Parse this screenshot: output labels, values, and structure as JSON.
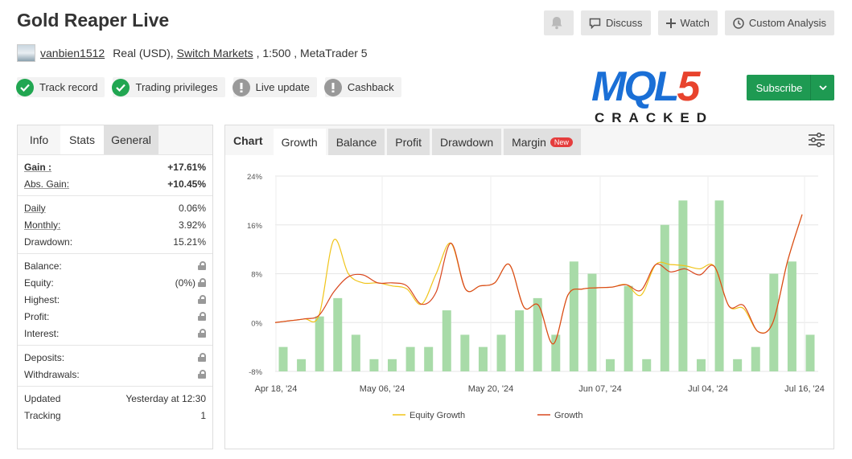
{
  "header": {
    "title": "Gold Reaper Live"
  },
  "buttons": {
    "discuss": "Discuss",
    "watch": "Watch",
    "custom": "Custom Analysis"
  },
  "account": {
    "user": "vanbien1512",
    "type": "Real (USD),",
    "broker": "Switch Markets",
    "rest": ", 1:500 , MetaTrader 5"
  },
  "badges": [
    {
      "label": "Track record"
    },
    {
      "label": "Trading privileges"
    },
    {
      "label": "Live update"
    },
    {
      "label": "Cashback"
    }
  ],
  "logo": {
    "big_a": "MQL",
    "big_b": "5",
    "small": "CRACKED"
  },
  "subscribe": {
    "label": "Subscribe"
  },
  "left_tabs": {
    "info": "Info",
    "stats": "Stats",
    "general": "General"
  },
  "stats": {
    "gain": {
      "k": "Gain :",
      "v": "+17.61%"
    },
    "abs_gain": {
      "k": "Abs. Gain:",
      "v": "+10.45%"
    },
    "daily": {
      "k": "Daily",
      "v": "0.06%"
    },
    "monthly": {
      "k": "Monthly:",
      "v": "3.92%"
    },
    "drawdown": {
      "k": "Drawdown:",
      "v": "15.21%"
    },
    "balance": {
      "k": "Balance:"
    },
    "equity": {
      "k": "Equity:",
      "v": "(0%)"
    },
    "highest": {
      "k": "Highest:"
    },
    "profit": {
      "k": "Profit:"
    },
    "interest": {
      "k": "Interest:"
    },
    "deposits": {
      "k": "Deposits:"
    },
    "withdrawals": {
      "k": "Withdrawals:"
    },
    "updated": {
      "k": "Updated",
      "v": "Yesterday at 12:30"
    },
    "tracking": {
      "k": "Tracking",
      "v": "1"
    }
  },
  "chart_tabs": {
    "chart": "Chart",
    "growth": "Growth",
    "balance": "Balance",
    "profit": "Profit",
    "drawdown": "Drawdown",
    "margin": "Margin",
    "new": "New"
  },
  "colors": {
    "equity": "#f0c419",
    "growth": "#d9481f",
    "bars": "#a8dba8",
    "accent": "#1e9a52"
  },
  "chart_data": {
    "type": "line",
    "yticks": [
      "24%",
      "16%",
      "8%",
      "0%",
      "-8%"
    ],
    "ylim": [
      -8,
      24
    ],
    "xticks": [
      "Apr 18, '24",
      "May 06, '24",
      "May 20, '24",
      "Jun 07, '24",
      "Jul 04, '24",
      "Jul 16, '24"
    ],
    "legend": [
      "Equity Growth",
      "Growth"
    ],
    "bars": [
      -4,
      -6,
      1,
      4,
      -2,
      -6,
      -6,
      -4,
      -4,
      2,
      -2,
      -4,
      -2,
      2,
      4,
      -2,
      10,
      8,
      -6,
      6,
      -6,
      16,
      20,
      -6,
      20,
      -6,
      -4,
      8,
      10,
      -2
    ],
    "growth": [
      0,
      0.3,
      0.6,
      1.2,
      5,
      7.5,
      7.8,
      6.5,
      6.5,
      6,
      3,
      5,
      13,
      5.5,
      6,
      6.5,
      9.5,
      2.5,
      2.8,
      -3.5,
      4.5,
      5.5,
      5.7,
      5.8,
      6.2,
      5.3,
      9.5,
      8.3,
      8.8,
      7.8,
      9.2,
      2.7,
      2.8,
      -1.5,
      0,
      10,
      17.7
    ],
    "equity": [
      0,
      0.3,
      0.6,
      1.2,
      13.5,
      8,
      6.5,
      6.5,
      6,
      5.5,
      3,
      8,
      13,
      5.5,
      6,
      6.5,
      9.5,
      2.5,
      2.8,
      -3.5,
      4.5,
      5.5,
      5.7,
      5.8,
      6.2,
      4.5,
      9.5,
      9.5,
      9.3,
      8.8,
      9.2,
      2.7,
      2.3,
      -1.5,
      0,
      10,
      17.7
    ]
  }
}
